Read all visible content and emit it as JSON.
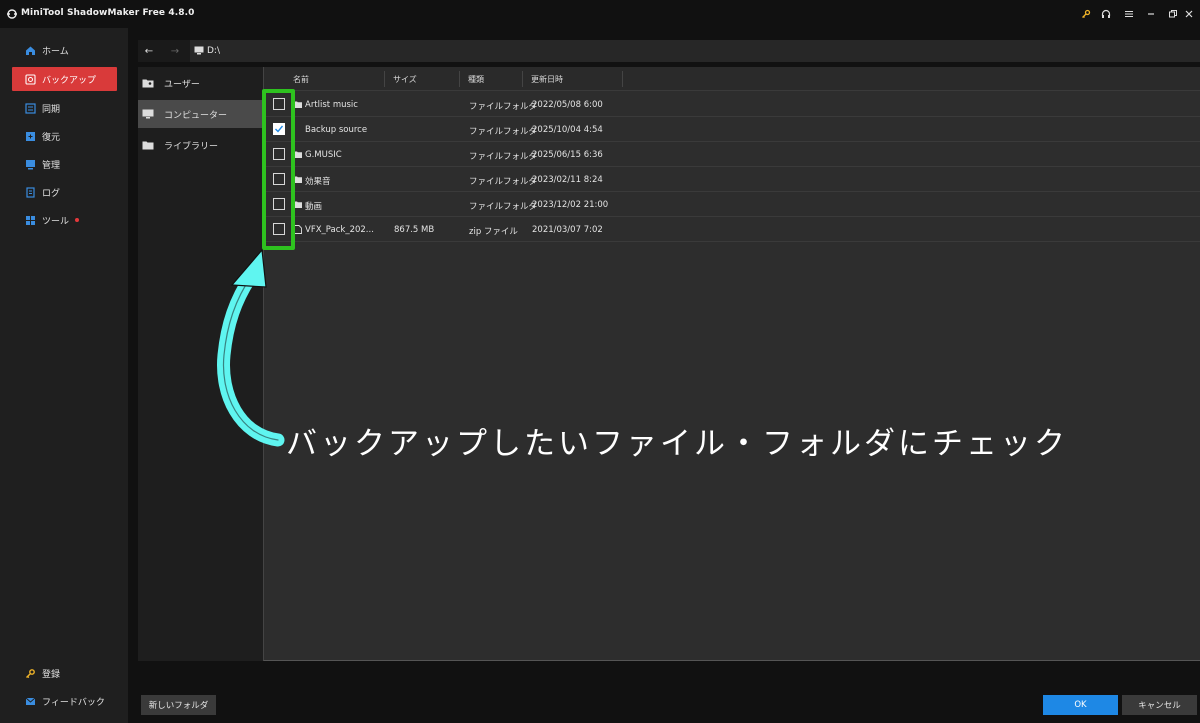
{
  "window": {
    "title": "MiniTool ShadowMaker Free 4.8.0"
  },
  "sidebar": {
    "items": [
      {
        "label": "ホーム",
        "icon": "home-icon",
        "active": false
      },
      {
        "label": "バックアップ",
        "icon": "backup-icon",
        "active": true
      },
      {
        "label": "同期",
        "icon": "sync-icon",
        "active": false
      },
      {
        "label": "復元",
        "icon": "restore-icon",
        "active": false
      },
      {
        "label": "管理",
        "icon": "manage-icon",
        "active": false
      },
      {
        "label": "ログ",
        "icon": "log-icon",
        "active": false
      },
      {
        "label": "ツール",
        "icon": "tools-icon",
        "active": false
      }
    ],
    "bottom": [
      {
        "label": "登録",
        "icon": "key-icon"
      },
      {
        "label": "フィードバック",
        "icon": "mail-icon"
      }
    ]
  },
  "pathbar": {
    "back": "←",
    "forward": "→",
    "path": "D:\\"
  },
  "tree": {
    "items": [
      {
        "label": "ユーザー",
        "icon": "user-folder-icon",
        "selected": false
      },
      {
        "label": "コンピューター",
        "icon": "computer-icon",
        "selected": true
      },
      {
        "label": "ライブラリー",
        "icon": "library-folder-icon",
        "selected": false
      }
    ]
  },
  "table": {
    "columns": [
      "名前",
      "サイズ",
      "種類",
      "更新日時"
    ],
    "rows": [
      {
        "name": "Artlist  music",
        "size": "",
        "type": "ファイルフォルダ",
        "modified": "2022/05/08 6:00",
        "checked": false,
        "icon": "folder-icon"
      },
      {
        "name": "Backup source",
        "size": "",
        "type": "ファイルフォルダ",
        "modified": "2025/10/04 4:54",
        "checked": true,
        "icon": "folder-icon"
      },
      {
        "name": "G.MUSIC",
        "size": "",
        "type": "ファイルフォルダ",
        "modified": "2025/06/15 6:36",
        "checked": false,
        "icon": "folder-icon"
      },
      {
        "name": "効果音",
        "size": "",
        "type": "ファイルフォルダ",
        "modified": "2023/02/11 8:24",
        "checked": false,
        "icon": "folder-icon"
      },
      {
        "name": "動画",
        "size": "",
        "type": "ファイルフォルダ",
        "modified": "2023/12/02 21:00",
        "checked": false,
        "icon": "folder-icon"
      },
      {
        "name": "VFX_Pack_202...",
        "size": "867.5 MB",
        "type": "zip ファイル",
        "modified": "2021/03/07 7:02",
        "checked": false,
        "icon": "file-icon"
      }
    ]
  },
  "buttons": {
    "new_folder": "新しいフォルダ",
    "ok": "OK",
    "cancel": "キャンセル"
  },
  "annotation": {
    "text": "バックアップしたいファイル・フォルダにチェック"
  },
  "colors": {
    "accent_red": "#d93a3a",
    "ok_blue": "#1e88e5",
    "highlight_green": "#2ec21f",
    "arrow_cyan": "#5ff5f0"
  }
}
